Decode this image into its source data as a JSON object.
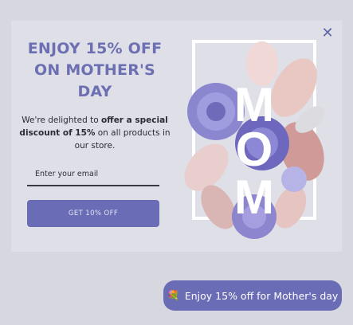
{
  "popup": {
    "title": "ENJOY 15% OFF ON MOTHER'S DAY",
    "desc_part1": "We're delighted to ",
    "desc_bold1": "offer a special discount of 15%",
    "desc_part2": " on all products in our store.",
    "email_placeholder": "Enter your email",
    "cta_label": "GET 10% OFF",
    "close_glyph": "✕",
    "art_word": "MOM"
  },
  "chip": {
    "icon": "flower-icon",
    "label": "Enjoy 15% off for Mother's day"
  },
  "colors": {
    "accent": "#6a6cb6",
    "title": "#6d6fb3",
    "popup_bg": "#dfdfe8",
    "page_bg": "#d7d7df"
  }
}
